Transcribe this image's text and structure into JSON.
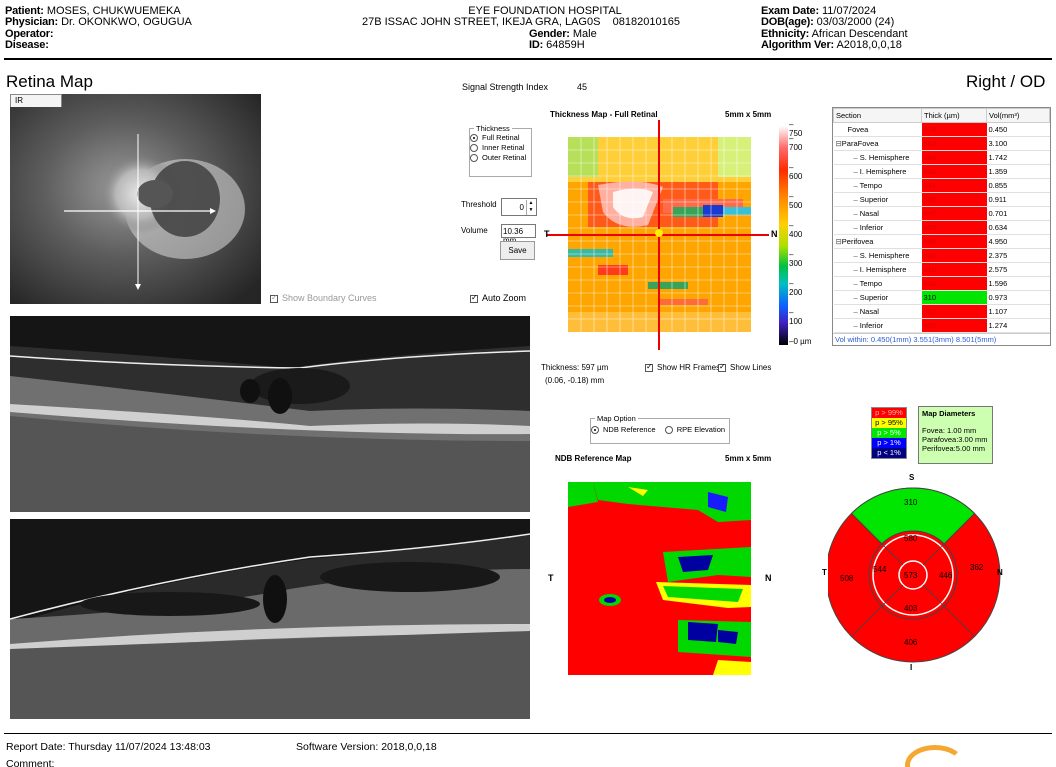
{
  "header": {
    "patient_label": "Patient:",
    "patient": "MOSES, CHUKWUEMEKA",
    "physician_label": "Physician:",
    "physician": "Dr. OKONKWO, OGUGUA",
    "operator_label": "Operator:",
    "disease_label": "Disease:",
    "hospital": "EYE FOUNDATION HOSPITAL",
    "address": "27B ISSAC JOHN STREET, IKEJA GRA, LAG0S",
    "phone": "08182010165",
    "gender_label": "Gender:",
    "gender": "Male",
    "id_label": "ID:",
    "id": "64859H",
    "exam_label": "Exam Date:",
    "exam": "11/07/2024",
    "dob_label": "DOB(age):",
    "dob": "03/03/2000 (24)",
    "eth_label": "Ethnicity:",
    "eth": "African Descendant",
    "algo_label": "Algorithm Ver:",
    "algo": "A2018,0,0,18"
  },
  "title_left": "Retina Map",
  "title_right": "Right / OD",
  "ir_tab": "IR",
  "signal_label": "Signal Strength Index",
  "signal_value": "45",
  "show_boundary": "Show Boundary Curves",
  "auto_zoom": "Auto Zoom",
  "thickness_group": {
    "legend": "Thickness",
    "options": [
      "Full Retinal",
      "Inner Retinal",
      "Outer Retinal"
    ]
  },
  "threshold_label": "Threshold",
  "threshold_value": "0",
  "volume_label": "Volume",
  "volume_value": "10.36 mm",
  "save_label": "Save",
  "thickmap": {
    "title": "Thickness Map - Full Retinal",
    "size": "5mm x 5mm",
    "t": "T",
    "n": "N",
    "scale_labels": [
      "750",
      "700",
      "600",
      "500",
      "400",
      "300",
      "200",
      "100",
      "0 µm"
    ],
    "thickness_text": "Thickness: 597 µm",
    "coord_text": "(0.06, -0.18) mm",
    "show_hr": "Show HR Frames",
    "show_lines": "Show Lines"
  },
  "map_option": {
    "legend": "Map Option",
    "opt1": "NDB Reference",
    "opt2": "RPE Elevation"
  },
  "ndb": {
    "title": "NDB Reference Map",
    "size": "5mm x 5mm",
    "t": "T",
    "n": "N"
  },
  "section_table": {
    "headers": [
      "Section",
      "Thick (µm)",
      "Vol(mm³)"
    ],
    "rows": [
      {
        "name": "Fovea",
        "thick": "573",
        "vol": "0.450",
        "c": "r",
        "lvl": 1
      },
      {
        "name": "ParaFovea",
        "thick": "563",
        "vol": "3.100",
        "c": "r",
        "lvl": 0
      },
      {
        "name": "S. Hemisphere",
        "thick": "584",
        "vol": "1.742",
        "c": "r",
        "lvl": 2
      },
      {
        "name": "I. Hemisphere",
        "thick": "532",
        "vol": "1.359",
        "c": "r",
        "lvl": 2
      },
      {
        "name": "Tempo",
        "thick": "544",
        "vol": "0.855",
        "c": "r",
        "lvl": 2
      },
      {
        "name": "Superior",
        "thick": "580",
        "vol": "0.911",
        "c": "r",
        "lvl": 2
      },
      {
        "name": "Nasal",
        "thick": "446",
        "vol": "0.701",
        "c": "r",
        "lvl": 2
      },
      {
        "name": "Inferior",
        "thick": "403",
        "vol": "0.634",
        "c": "r",
        "lvl": 2
      },
      {
        "name": "Perifovea",
        "thick": "394",
        "vol": "4.950",
        "c": "r",
        "lvl": 0
      },
      {
        "name": "S. Hemisphere",
        "thick": "328",
        "vol": "2.375",
        "c": "r",
        "lvl": 2
      },
      {
        "name": "I. Hemisphere",
        "thick": "410",
        "vol": "2.575",
        "c": "r",
        "lvl": 2
      },
      {
        "name": "Tempo",
        "thick": "508",
        "vol": "1.596",
        "c": "r",
        "lvl": 2
      },
      {
        "name": "Superior",
        "thick": "310",
        "vol": "0.973",
        "c": "g",
        "lvl": 2
      },
      {
        "name": "Nasal",
        "thick": "362",
        "vol": "1.107",
        "c": "r",
        "lvl": 2
      },
      {
        "name": "Inferior",
        "thick": "406",
        "vol": "1.274",
        "c": "r",
        "lvl": 2
      }
    ],
    "vol_within": "Vol within: 0.450(1mm) 3.551(3mm) 8.501(5mm)"
  },
  "pct_legend": [
    {
      "t": "p > 99%",
      "c": "#ff0000",
      "tc": "#ffb0b0"
    },
    {
      "t": "p > 95%",
      "c": "#ffff00",
      "tc": "#000"
    },
    {
      "t": "p > 5%",
      "c": "#00e600",
      "tc": "#fff"
    },
    {
      "t": "p > 1%",
      "c": "#0000ff",
      "tc": "#fff"
    },
    {
      "t": "p < 1%",
      "c": "#000080",
      "tc": "#fff"
    }
  ],
  "diameters": {
    "title": "Map Diameters",
    "fovea": "Fovea:     1.00 mm",
    "para": "Parafovea:3.00 mm",
    "peri": "Perifovea:5.00 mm"
  },
  "etdrs": {
    "s": "S",
    "i": "I",
    "t": "T",
    "n": "N",
    "center": "573",
    "inner_sup": "580",
    "inner_nas": "446",
    "inner_inf": "403",
    "inner_tmp": "544",
    "outer_sup": "310",
    "outer_nas": "362",
    "outer_inf": "406",
    "outer_tmp": "508"
  },
  "colors": {
    "red": "#ff0000",
    "green": "#00e600"
  },
  "footer": {
    "report": "Report Date: Thursday 11/07/2024 13:48:03",
    "software": "Software Version: 2018,0,0,18",
    "comment": "Comment:"
  }
}
